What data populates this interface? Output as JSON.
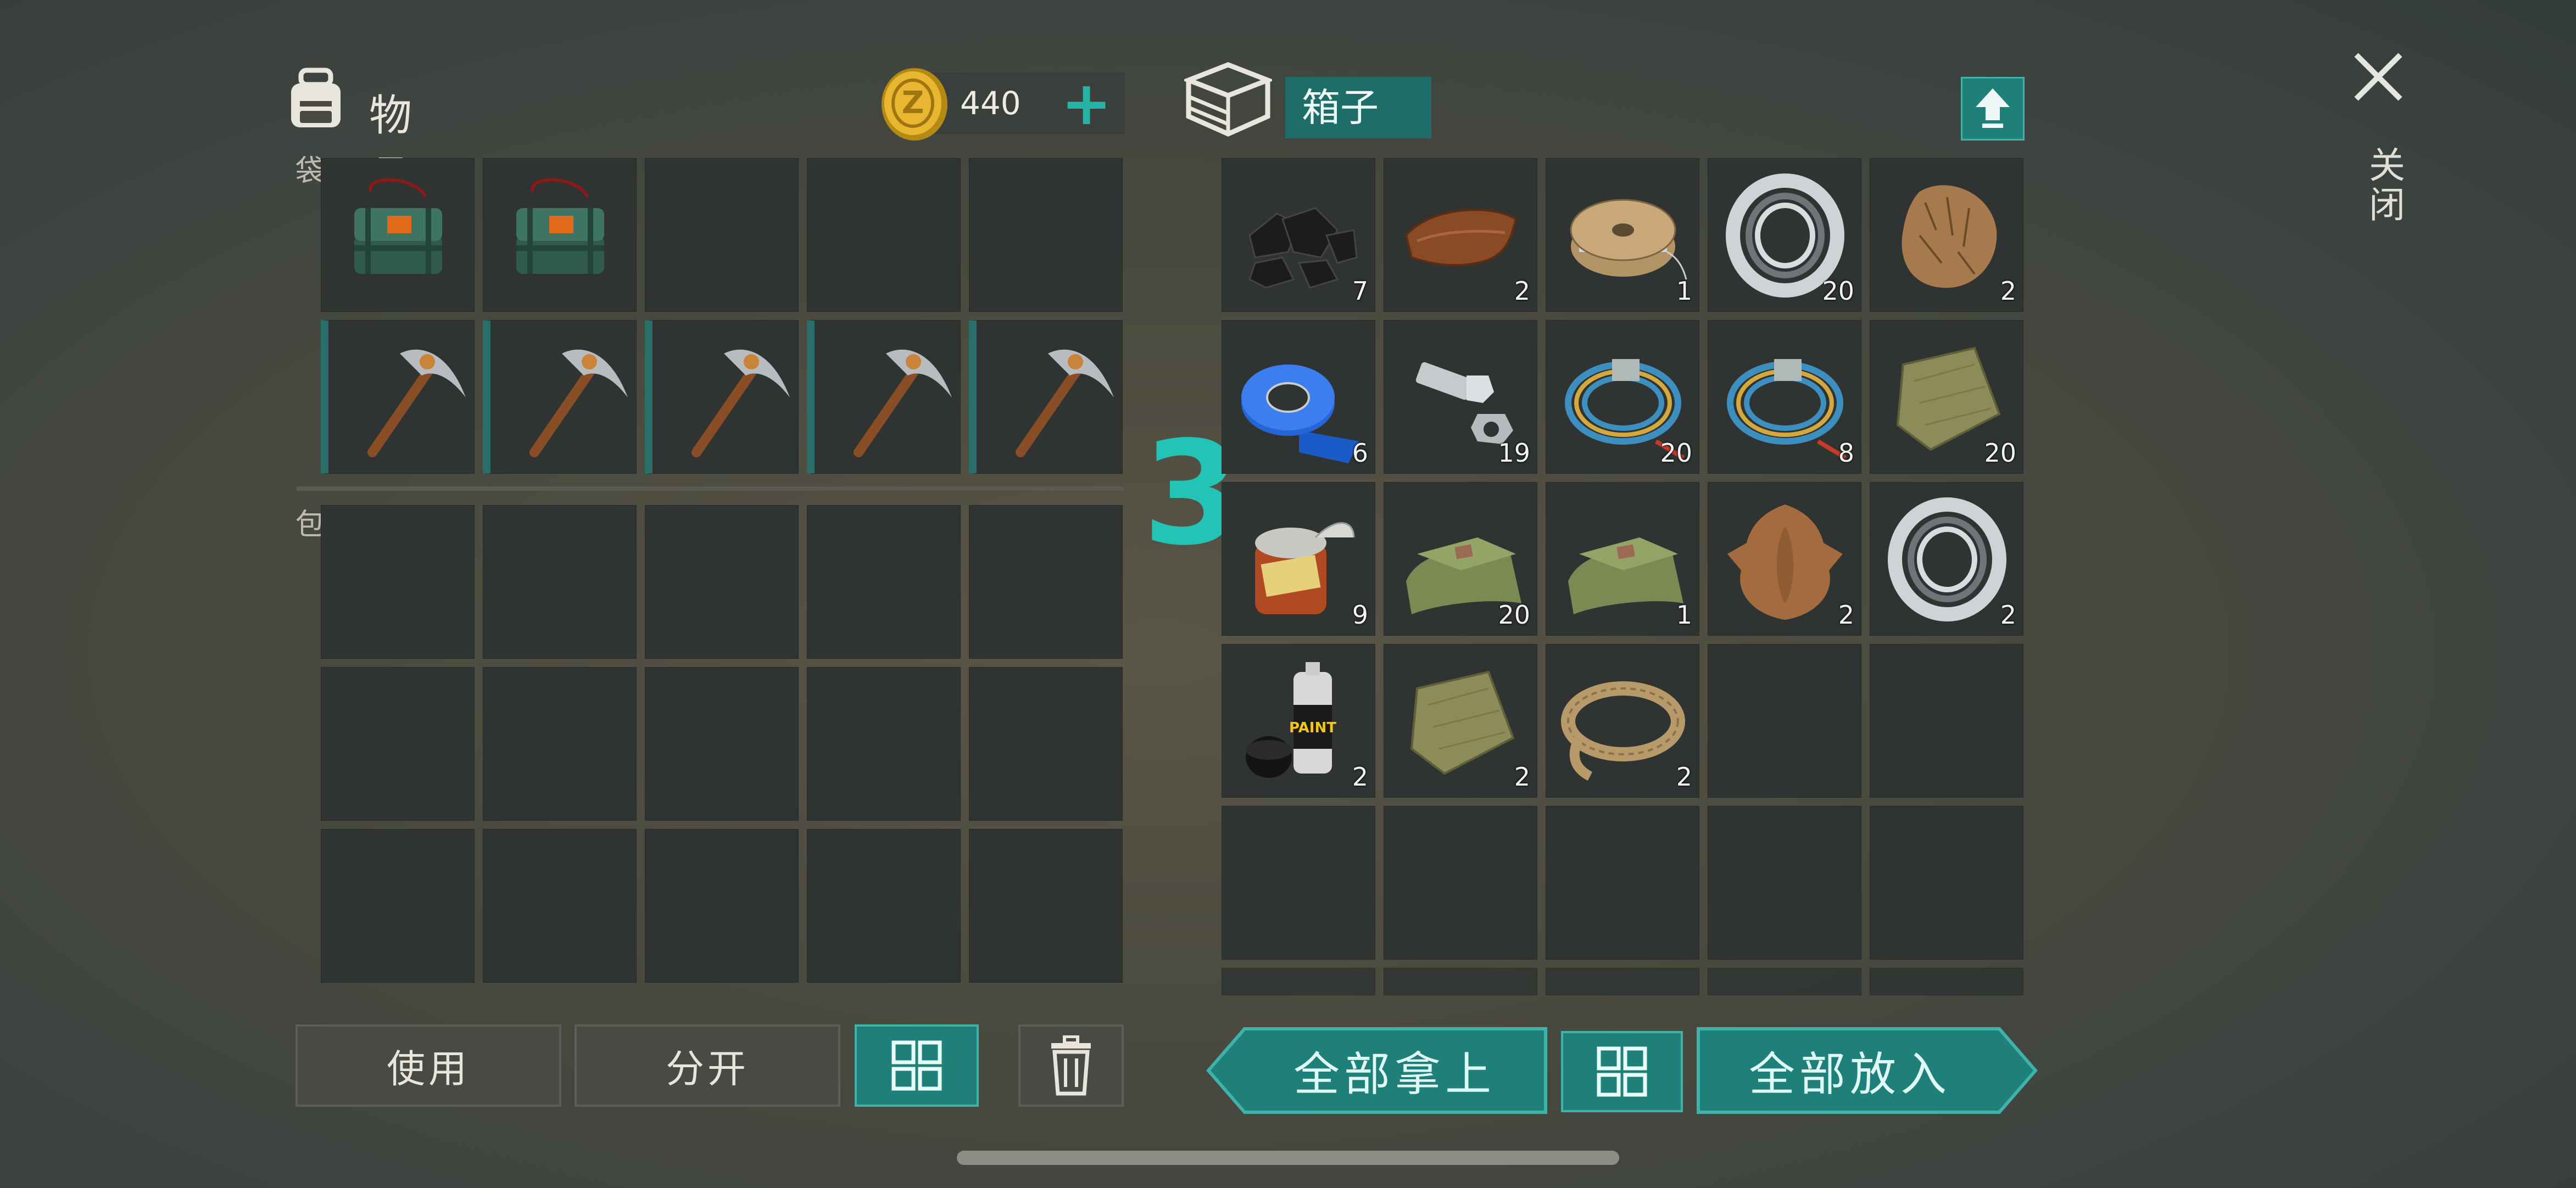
{
  "inventory": {
    "title": "物品栏",
    "coins": "440",
    "pocket_label": "口袋",
    "backpack_label": "背包"
  },
  "container": {
    "title": "箱子",
    "slots": [
      {
        "item": "coal-icon",
        "count": "7"
      },
      {
        "item": "leather-icon",
        "count": "2"
      },
      {
        "item": "wire-spool-icon",
        "count": "1"
      },
      {
        "item": "bearing-icon",
        "count": "20"
      },
      {
        "item": "fur-icon",
        "count": "2"
      },
      {
        "item": "duct-tape-icon",
        "count": "6"
      },
      {
        "item": "bolts-icon",
        "count": "19"
      },
      {
        "item": "cable-icon",
        "count": "20"
      },
      {
        "item": "cable-icon",
        "count": "8"
      },
      {
        "item": "cloth-icon",
        "count": "20"
      },
      {
        "item": "canned-food-icon",
        "count": "9"
      },
      {
        "item": "fabric-icon",
        "count": "20"
      },
      {
        "item": "fabric-icon",
        "count": "1"
      },
      {
        "item": "animal-hide-icon",
        "count": "2"
      },
      {
        "item": "bearing-icon",
        "count": "2"
      },
      {
        "item": "spray-paint-icon",
        "count": "2"
      },
      {
        "item": "cloth-icon",
        "count": "2"
      },
      {
        "item": "rope-icon",
        "count": "2"
      }
    ]
  },
  "overlay_number": "3",
  "close": {
    "label": "关闭"
  },
  "buttons": {
    "use": "使用",
    "split": "分开",
    "take_all": "全部拿上",
    "put_all": "全部放入"
  },
  "colors": {
    "accent": "#1f7f79",
    "accent_light": "#3fb3ab",
    "overlay_number": "#22c4b6"
  }
}
